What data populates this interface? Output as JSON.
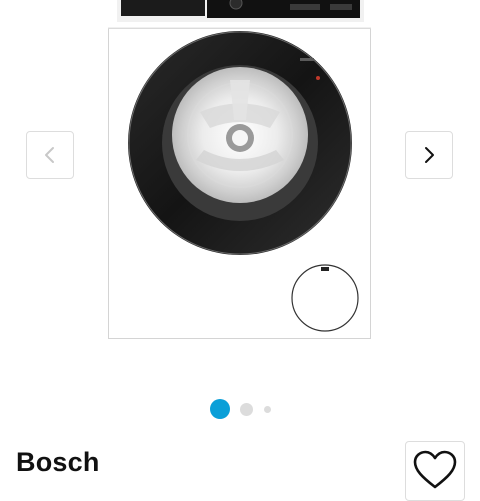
{
  "product": {
    "brand": "Bosch"
  },
  "gallery": {
    "image_count": 3,
    "active_index": 1,
    "image_subject": "washing-machine",
    "prev_icon": "chevron-left-icon",
    "next_icon": "chevron-right-icon"
  },
  "actions": {
    "wishlist_icon": "heart-icon"
  },
  "colors": {
    "active_dot": "#0a9fd8",
    "inactive_dot": "#dcdcdc",
    "border": "#dddddd",
    "text": "#111111"
  }
}
